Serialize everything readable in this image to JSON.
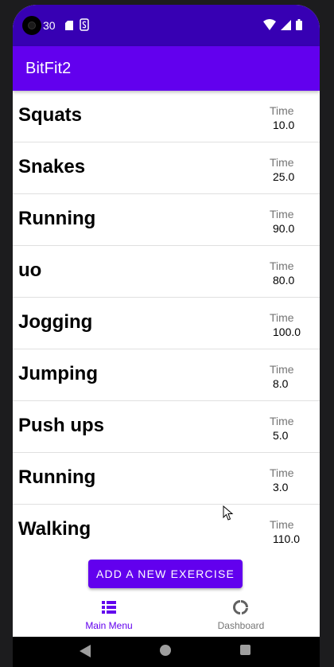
{
  "status_bar": {
    "time": "30"
  },
  "app_bar": {
    "title": "BitFit2"
  },
  "exercises": [
    {
      "name": "Squats",
      "time_label": "Time",
      "time": "10.0"
    },
    {
      "name": "Snakes",
      "time_label": "Time",
      "time": "25.0"
    },
    {
      "name": "Running",
      "time_label": "Time",
      "time": "90.0"
    },
    {
      "name": "uo",
      "time_label": "Time",
      "time": "80.0"
    },
    {
      "name": "Jogging",
      "time_label": "Time",
      "time": "100.0"
    },
    {
      "name": "Jumping",
      "time_label": "Time",
      "time": "8.0"
    },
    {
      "name": "Push ups",
      "time_label": "Time",
      "time": "5.0"
    },
    {
      "name": "Running",
      "time_label": "Time",
      "time": "3.0"
    },
    {
      "name": "Walking",
      "time_label": "Time",
      "time": "110.0"
    }
  ],
  "add_button": {
    "label": "ADD A NEW EXERCISE"
  },
  "bottom_nav": {
    "items": [
      {
        "label": "Main Menu",
        "icon": "list-icon",
        "selected": true
      },
      {
        "label": "Dashboard",
        "icon": "donut-chart-icon",
        "selected": false
      }
    ]
  },
  "colors": {
    "primary": "#6200ee",
    "primary_dark": "#3700b3",
    "divider": "#e0e0e0",
    "label_gray": "#757575"
  }
}
